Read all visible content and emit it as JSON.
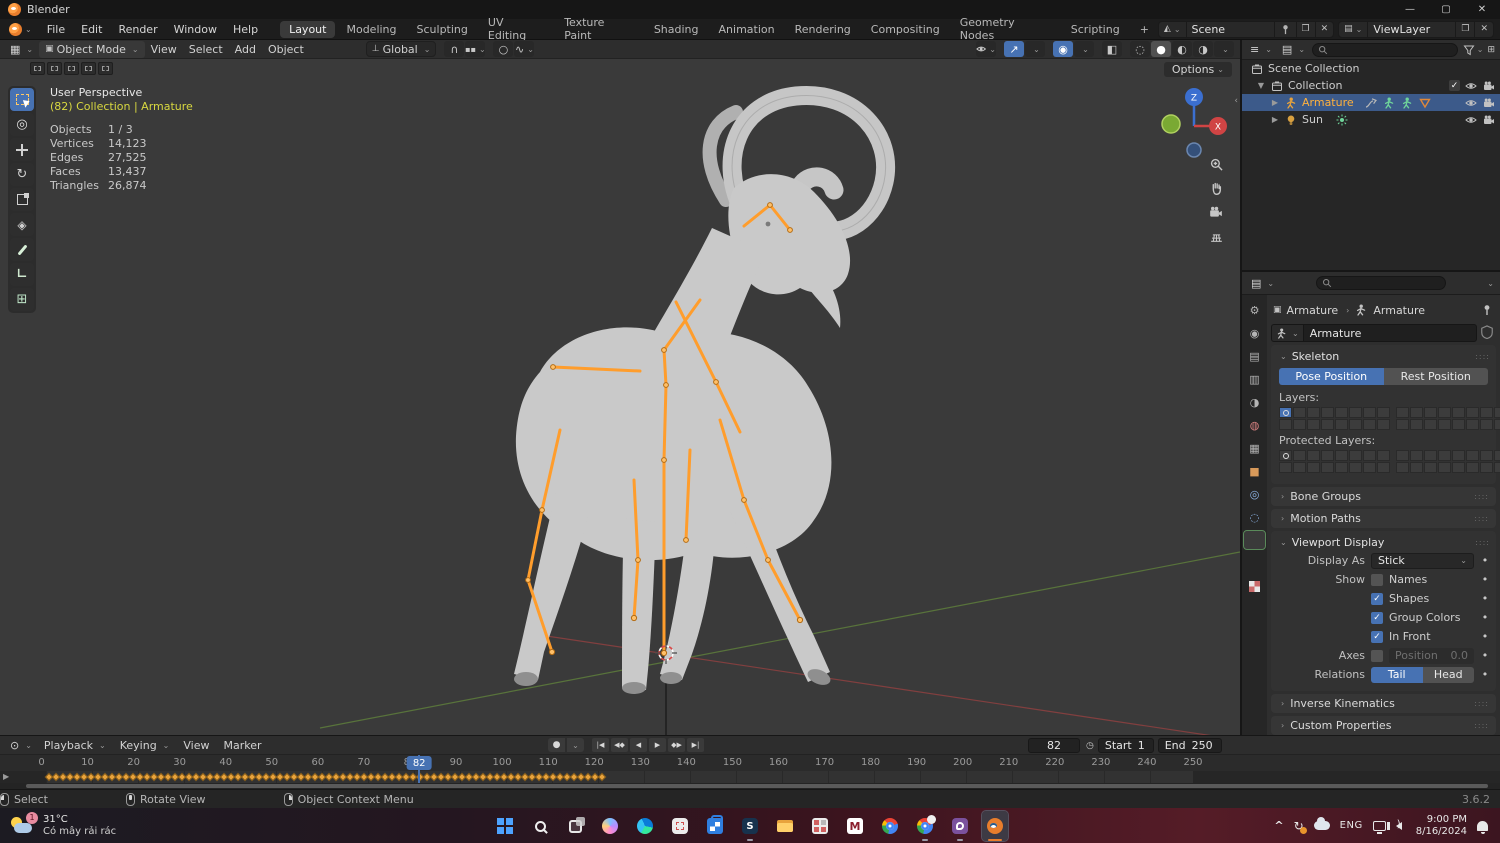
{
  "colors": {
    "accent": "#4772b3",
    "selected_text": "#ffb13d",
    "keyframe": "#e8a33c"
  },
  "titlebar": {
    "title": "Blender"
  },
  "menubar": {
    "menus": [
      "File",
      "Edit",
      "Render",
      "Window",
      "Help"
    ],
    "workspaces": [
      {
        "label": "Layout",
        "active": true
      },
      {
        "label": "Modeling"
      },
      {
        "label": "Sculpting"
      },
      {
        "label": "UV Editing"
      },
      {
        "label": "Texture Paint"
      },
      {
        "label": "Shading"
      },
      {
        "label": "Animation"
      },
      {
        "label": "Rendering"
      },
      {
        "label": "Compositing"
      },
      {
        "label": "Geometry Nodes"
      },
      {
        "label": "Scripting"
      },
      {
        "label": "+"
      }
    ],
    "scene": "Scene",
    "view_layer": "ViewLayer"
  },
  "viewport": {
    "mode": "Object Mode",
    "menus": [
      "View",
      "Select",
      "Add",
      "Object"
    ],
    "orientation": "Global",
    "options": "Options",
    "tools": [
      {
        "name": "select-box",
        "active": true
      },
      {
        "name": "cursor"
      },
      {
        "name": "move"
      },
      {
        "name": "rotate"
      },
      {
        "name": "scale"
      },
      {
        "name": "transform"
      },
      {
        "name": "annotate"
      },
      {
        "name": "measure"
      },
      {
        "name": "add-cube"
      }
    ],
    "overlay": {
      "view": "User Perspective",
      "context": "(82) Collection | Armature",
      "stats": [
        {
          "label": "Objects",
          "value": "1 / 3"
        },
        {
          "label": "Vertices",
          "value": "14,123"
        },
        {
          "label": "Edges",
          "value": "27,525"
        },
        {
          "label": "Faces",
          "value": "13,437"
        },
        {
          "label": "Triangles",
          "value": "26,874"
        }
      ]
    },
    "axis_labels": {
      "x": "X",
      "z": "Z"
    }
  },
  "outliner": {
    "scene_collection": "Scene Collection",
    "collection": "Collection",
    "armature": "Armature",
    "sun": "Sun"
  },
  "properties": {
    "tabs": [
      {
        "name": "tool"
      },
      {
        "name": "render"
      },
      {
        "name": "output"
      },
      {
        "name": "view-layer"
      },
      {
        "name": "scene"
      },
      {
        "name": "world"
      },
      {
        "name": "collection"
      },
      {
        "name": "object"
      },
      {
        "name": "constraints"
      },
      {
        "name": "physics"
      },
      {
        "name": "object-data",
        "active": true
      },
      {
        "name": "bone"
      },
      {
        "name": "texture"
      }
    ],
    "breadcrumb": {
      "object": "Armature",
      "data": "Armature"
    },
    "name_value": "Armature",
    "skeleton": {
      "title": "Skeleton",
      "pose": "Pose Position",
      "rest": "Rest Position",
      "layers": "Layers:",
      "protected": "Protected Layers:"
    },
    "bone_groups": "Bone Groups",
    "motion_paths": "Motion Paths",
    "viewport_display": {
      "title": "Viewport Display",
      "display_as_label": "Display As",
      "display_as": "Stick",
      "show_label": "Show",
      "checks": [
        {
          "label": "Names",
          "active": false
        },
        {
          "label": "Shapes",
          "active": true
        },
        {
          "label": "Group Colors",
          "active": true
        },
        {
          "label": "In Front",
          "active": true
        }
      ],
      "axes_label": "Axes",
      "position_placeholder": "Position",
      "position_value": "0.0",
      "relations_label": "Relations",
      "relations": [
        {
          "label": "Tail",
          "active": true
        },
        {
          "label": "Head"
        }
      ]
    },
    "inverse_kinematics": "Inverse Kinematics",
    "custom_properties": "Custom Properties"
  },
  "timeline": {
    "menus": [
      "Playback",
      "Keying",
      "View",
      "Marker"
    ],
    "transport": [
      {
        "name": "jump-to-start",
        "glyph": "|◀"
      },
      {
        "name": "previous-keyframe",
        "glyph": "◀◆"
      },
      {
        "name": "play-reverse",
        "glyph": "◀"
      },
      {
        "name": "play",
        "glyph": "▶"
      },
      {
        "name": "next-keyframe",
        "glyph": "◆▶"
      },
      {
        "name": "jump-to-end",
        "glyph": "▶|"
      }
    ],
    "current_frame": "82",
    "start_label": "Start",
    "start_value": "1",
    "end_label": "End",
    "end_value": "250",
    "ticks": [
      0,
      10,
      20,
      30,
      40,
      50,
      60,
      70,
      80,
      90,
      100,
      110,
      120,
      130,
      140,
      150,
      160,
      170,
      180,
      190,
      200,
      210,
      220,
      230,
      240,
      250
    ],
    "keyframe_range": {
      "first": 1,
      "last": 122
    }
  },
  "statusbar": {
    "hints": [
      {
        "button": "left",
        "label": "Select"
      },
      {
        "button": "middle",
        "label": "Rotate View"
      },
      {
        "button": "right",
        "label": "Object Context Menu"
      }
    ],
    "version": "3.6.2"
  },
  "taskbar": {
    "weather": {
      "badge": "1",
      "temp": "31°C",
      "desc": "Có mây rải rác"
    },
    "icons": [
      {
        "name": "start"
      },
      {
        "name": "search"
      },
      {
        "name": "task-view"
      },
      {
        "name": "copilot"
      },
      {
        "name": "edge"
      },
      {
        "name": "snipping-tool"
      },
      {
        "name": "store"
      },
      {
        "name": "s-app",
        "running": true
      },
      {
        "name": "file-explorer"
      },
      {
        "name": "boards-app"
      },
      {
        "name": "m-app"
      },
      {
        "name": "chrome"
      },
      {
        "name": "chrome-alt",
        "running": true
      },
      {
        "name": "viber",
        "running": true
      },
      {
        "name": "blender",
        "active": true
      }
    ],
    "tray": {
      "language": "ENG",
      "time": "9:00 PM",
      "date": "8/16/2024"
    }
  }
}
